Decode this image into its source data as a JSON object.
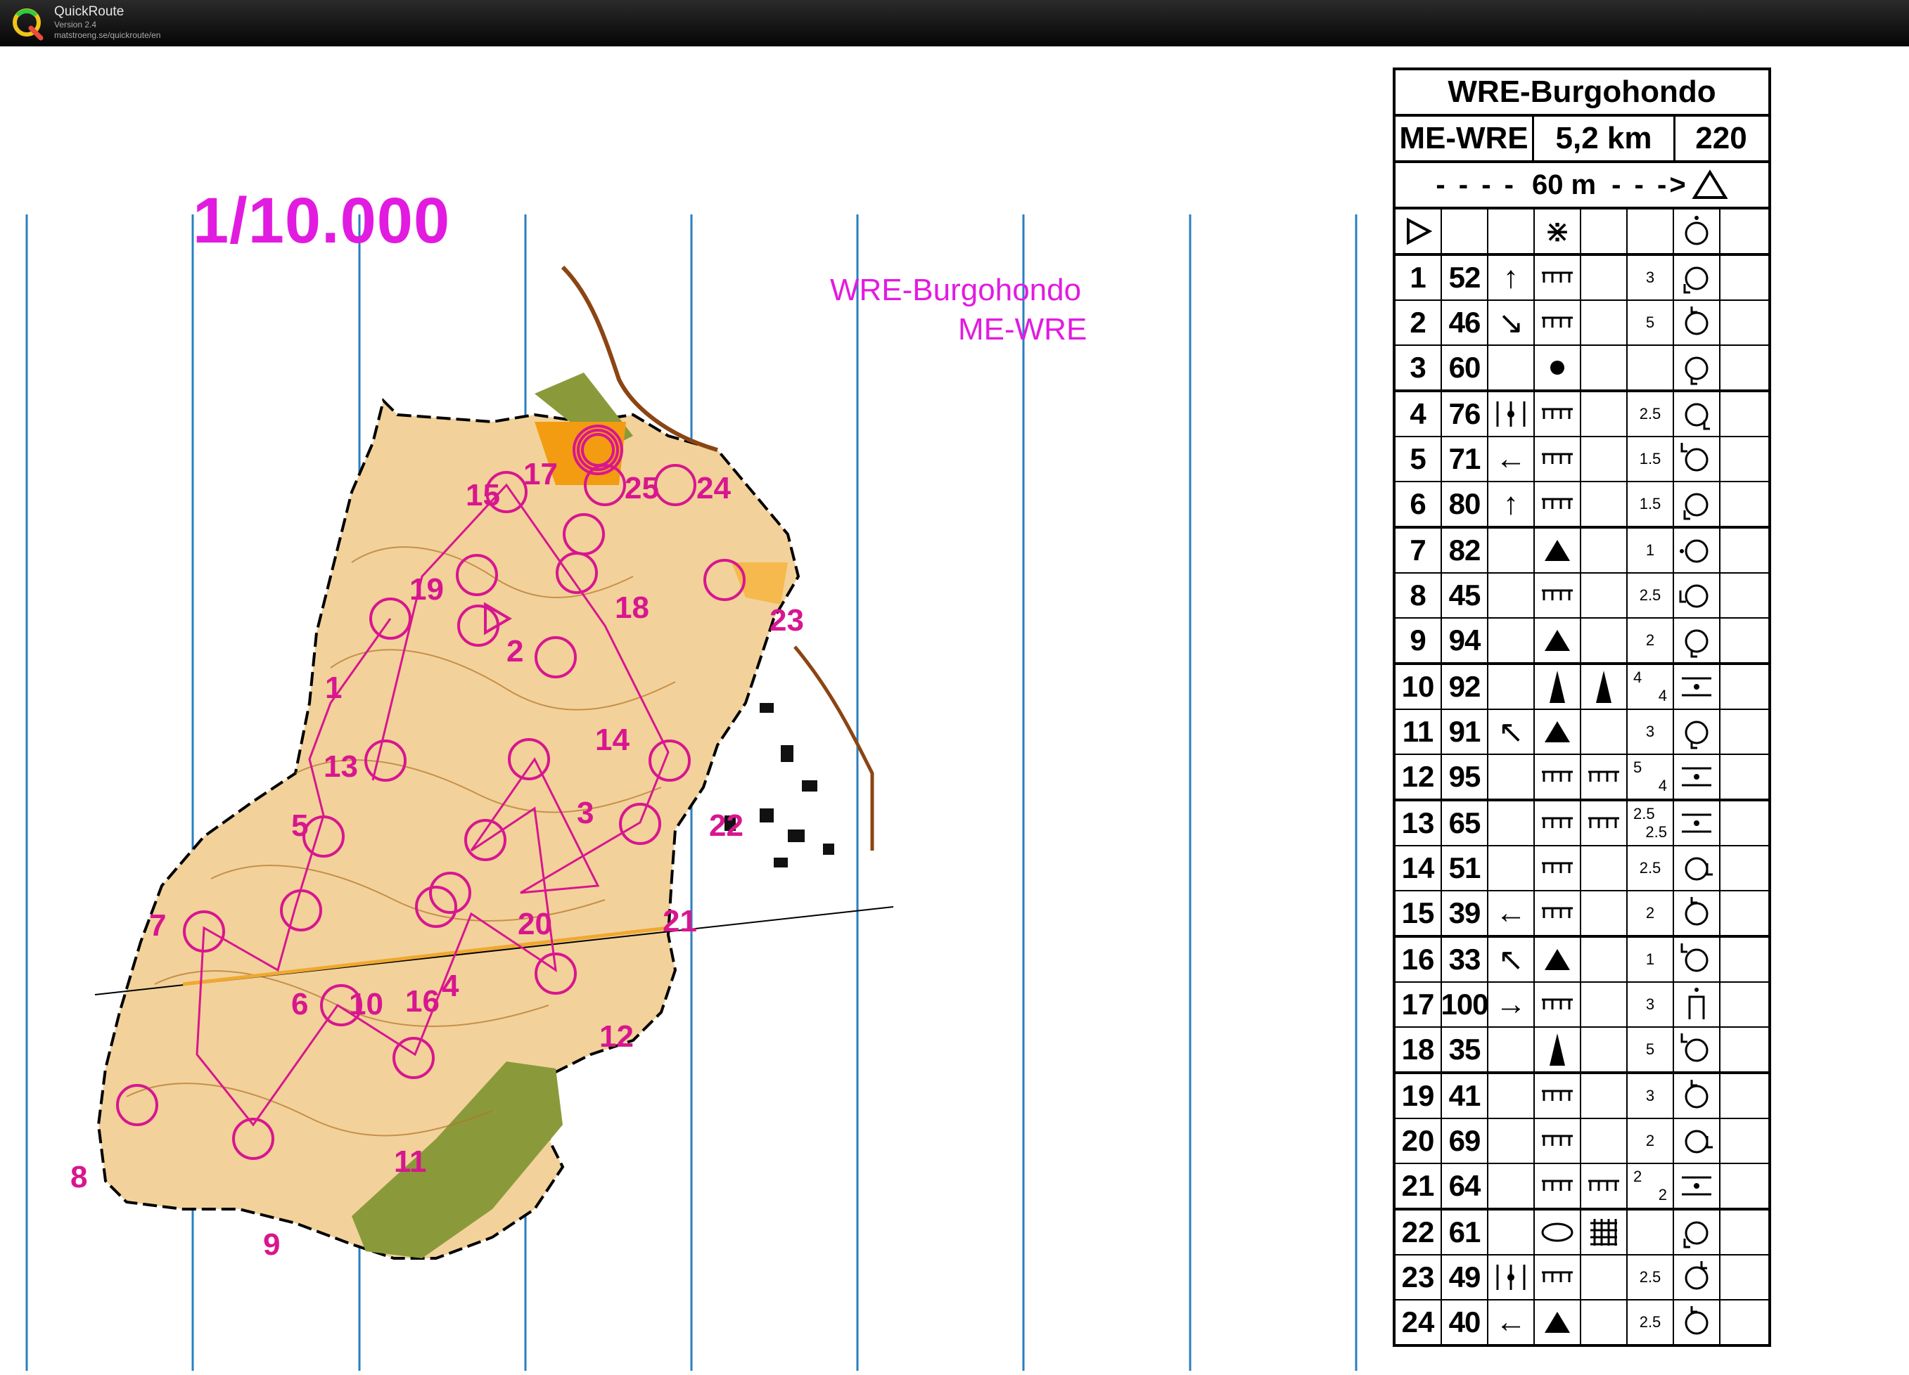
{
  "app": {
    "title": "QuickRoute",
    "version": "Version 2.4",
    "url": "matstroeng.se/quickroute/en"
  },
  "map": {
    "scale": "1/10.000",
    "event": "WRE-Burgohondo",
    "class": "ME-WRE",
    "control_labels": [
      "1",
      "2",
      "3",
      "4",
      "5",
      "6",
      "7",
      "8",
      "9",
      "10",
      "11",
      "12",
      "13",
      "14",
      "15",
      "16",
      "17",
      "18",
      "19",
      "20",
      "21",
      "22",
      "23",
      "24",
      "25"
    ],
    "accent_color": "#e21be0"
  },
  "description_sheet": {
    "event": "WRE-Burgohondo",
    "class": "ME-WRE",
    "length": "5,2 km",
    "climb": "220",
    "finish_note": "60 m",
    "controls": [
      {
        "n": "1",
        "code": "52",
        "dir": "↑",
        "feat": "cliff",
        "dim": "3",
        "pos": "bottom-left"
      },
      {
        "n": "2",
        "code": "46",
        "dir": "↘",
        "feat": "cliff",
        "dim": "5",
        "pos": "top"
      },
      {
        "n": "3",
        "code": "60",
        "dir": "",
        "feat": "dot",
        "dim": "",
        "pos": "bottom"
      },
      {
        "n": "4",
        "code": "76",
        "dir": "middle",
        "feat": "cliff",
        "dim": "2.5",
        "pos": "bottom-right"
      },
      {
        "n": "5",
        "code": "71",
        "dir": "←",
        "feat": "cliff",
        "dim": "1.5",
        "pos": "top-left"
      },
      {
        "n": "6",
        "code": "80",
        "dir": "↑",
        "feat": "cliff",
        "dim": "1.5",
        "pos": "bottom-left"
      },
      {
        "n": "7",
        "code": "82",
        "dir": "",
        "feat": "boulder",
        "dim": "1",
        "pos": "left"
      },
      {
        "n": "8",
        "code": "45",
        "dir": "",
        "feat": "cliff",
        "dim": "2.5",
        "pos": "left-foot"
      },
      {
        "n": "9",
        "code": "94",
        "dir": "",
        "feat": "boulder",
        "dim": "2",
        "pos": "bottom"
      },
      {
        "n": "10",
        "code": "92",
        "dir": "",
        "feat": "pillar",
        "feat2": "pillar",
        "dim": "4 4",
        "pos": "between"
      },
      {
        "n": "11",
        "code": "91",
        "dir": "↖",
        "feat": "boulder",
        "dim": "3",
        "pos": "bottom"
      },
      {
        "n": "12",
        "code": "95",
        "dir": "",
        "feat": "cliff",
        "feat2": "cliff",
        "dim": "5 4",
        "pos": "between"
      },
      {
        "n": "13",
        "code": "65",
        "dir": "",
        "feat": "cliff",
        "feat2": "cliff",
        "dim": "2.5 2.5",
        "pos": "between"
      },
      {
        "n": "14",
        "code": "51",
        "dir": "",
        "feat": "cliff",
        "dim": "2.5",
        "pos": "right"
      },
      {
        "n": "15",
        "code": "39",
        "dir": "←",
        "feat": "cliff",
        "dim": "2",
        "pos": "top"
      },
      {
        "n": "16",
        "code": "33",
        "dir": "↖",
        "feat": "boulder",
        "dim": "1",
        "pos": "top-left"
      },
      {
        "n": "17",
        "code": "100",
        "dir": "→",
        "feat": "cliff",
        "dim": "3",
        "pos": "gap"
      },
      {
        "n": "18",
        "code": "35",
        "dir": "",
        "feat": "pillar",
        "dim": "5",
        "pos": "top-left"
      },
      {
        "n": "19",
        "code": "41",
        "dir": "",
        "feat": "cliff",
        "dim": "3",
        "pos": "top"
      },
      {
        "n": "20",
        "code": "69",
        "dir": "",
        "feat": "cliff",
        "dim": "2",
        "pos": "right"
      },
      {
        "n": "21",
        "code": "64",
        "dir": "",
        "feat": "cliff",
        "feat2": "cliff",
        "dim": "2 2",
        "pos": "between"
      },
      {
        "n": "22",
        "code": "61",
        "dir": "",
        "feat": "ellipse",
        "feat2": "grid",
        "dim": "",
        "pos": "bottom-left"
      },
      {
        "n": "23",
        "code": "49",
        "dir": "middle",
        "feat": "cliff",
        "dim": "2.5",
        "pos": "top-right"
      },
      {
        "n": "24",
        "code": "40",
        "dir": "←",
        "feat": "boulder",
        "dim": "2.5",
        "pos": "top"
      }
    ]
  }
}
